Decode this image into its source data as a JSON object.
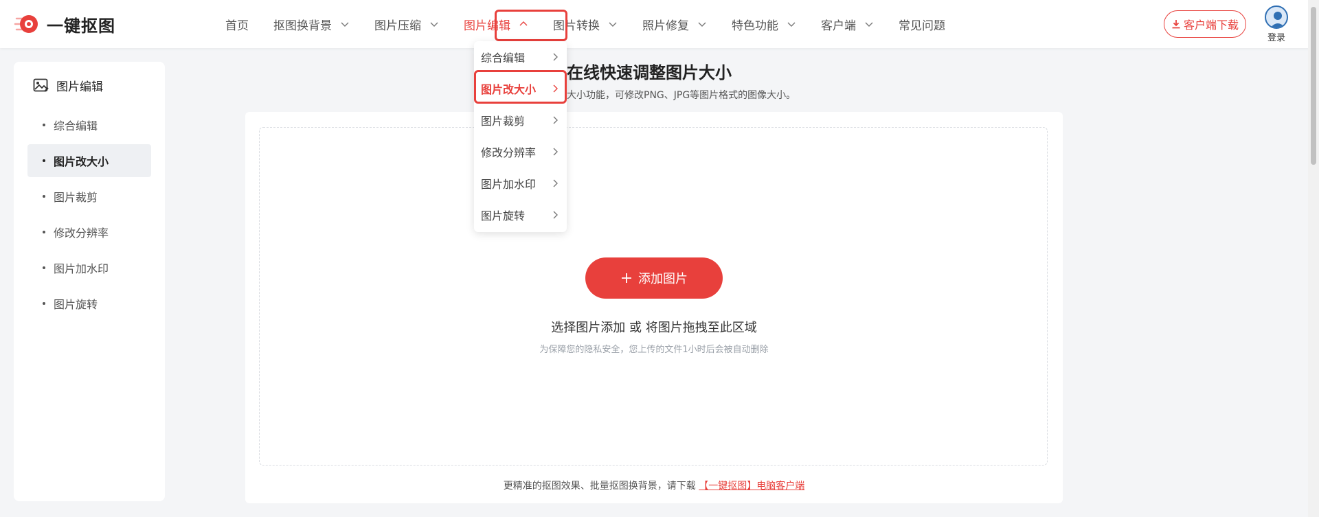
{
  "brand": {
    "name": "一键抠图",
    "accent": "#e8403c"
  },
  "nav": {
    "items": [
      {
        "label": "首页",
        "has_chevron": false
      },
      {
        "label": "抠图换背景",
        "has_chevron": true
      },
      {
        "label": "图片压缩",
        "has_chevron": true
      },
      {
        "label": "图片编辑",
        "has_chevron": true,
        "active": true
      },
      {
        "label": "图片转换",
        "has_chevron": true
      },
      {
        "label": "照片修复",
        "has_chevron": true
      },
      {
        "label": "特色功能",
        "has_chevron": true
      },
      {
        "label": "客户端",
        "has_chevron": true
      },
      {
        "label": "常见问题",
        "has_chevron": false
      }
    ],
    "download_label": "客户端下载",
    "login_label": "登录"
  },
  "dropdown": {
    "items": [
      {
        "label": "综合编辑"
      },
      {
        "label": "图片改大小",
        "active": true
      },
      {
        "label": "图片裁剪"
      },
      {
        "label": "修改分辨率"
      },
      {
        "label": "图片加水印"
      },
      {
        "label": "图片旋转"
      }
    ]
  },
  "sidebar": {
    "title": "图片编辑",
    "items": [
      {
        "label": "综合编辑"
      },
      {
        "label": "图片改大小",
        "active": true
      },
      {
        "label": "图片裁剪"
      },
      {
        "label": "修改分辨率"
      },
      {
        "label": "图片加水印"
      },
      {
        "label": "图片旋转"
      }
    ]
  },
  "main": {
    "title": "在线快速调整图片大小",
    "subtitle": "大小功能，可修改PNG、JPG等图片格式的图像大小。",
    "add_button_label": "添加图片",
    "hint_primary": "选择图片添加 或 将图片拖拽至此区域",
    "hint_secondary": "为保障您的隐私安全，您上传的文件1小时后会被自动删除",
    "footer_text": "更精准的抠图效果、批量抠图换背景，请下载",
    "footer_link": "【一键抠图】电脑客户端"
  }
}
